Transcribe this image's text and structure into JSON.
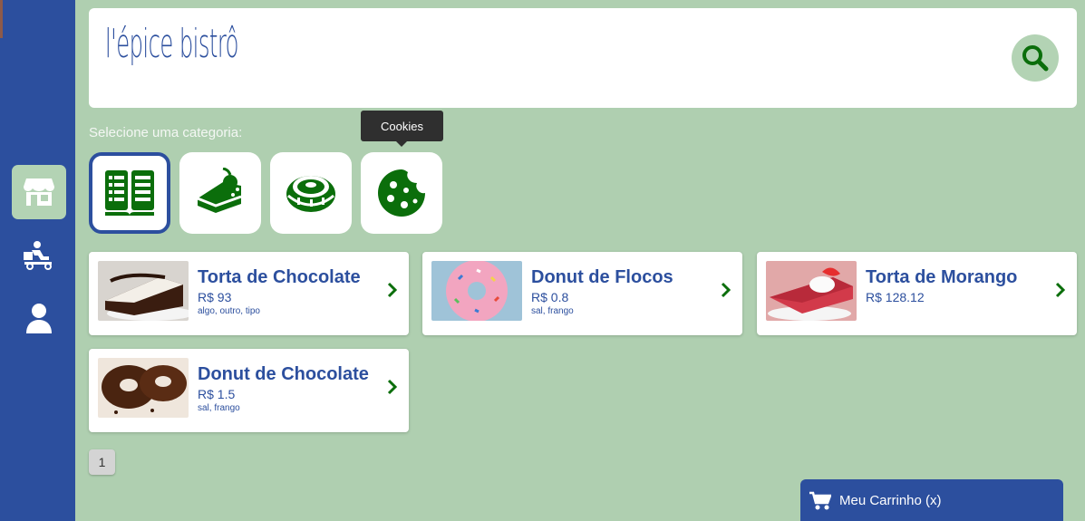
{
  "brand": {
    "logo_text": "l'épice bistrô"
  },
  "sidebar": {
    "items": [
      {
        "icon": "store-icon",
        "active": true
      },
      {
        "icon": "delivery-icon",
        "active": false
      },
      {
        "icon": "user-icon",
        "active": false
      }
    ]
  },
  "categories": {
    "label": "Selecione uma categoria:",
    "tooltip": "Cookies",
    "items": [
      {
        "icon": "menu-book-icon",
        "selected": true
      },
      {
        "icon": "cake-icon",
        "selected": false
      },
      {
        "icon": "donut-icon",
        "selected": false
      },
      {
        "icon": "cookie-icon",
        "selected": false
      }
    ]
  },
  "products": [
    {
      "name": "Torta de Chocolate",
      "price": "R$ 93",
      "tags": "algo, outro, tipo"
    },
    {
      "name": "Donut de Flocos",
      "price": "R$ 0.8",
      "tags": "sal, frango"
    },
    {
      "name": "Torta de Morango",
      "price": "R$ 128.12",
      "tags": ""
    },
    {
      "name": "Donut de Chocolate",
      "price": "R$ 1.5",
      "tags": "sal, frango"
    }
  ],
  "pagination": {
    "current": "1"
  },
  "cart": {
    "label": "Meu Carrinho (x)"
  },
  "colors": {
    "primary": "#2c4f9e",
    "accent_green": "#0b6e0b",
    "background": "#afcfb0",
    "active_bg": "#b3d3b4"
  }
}
